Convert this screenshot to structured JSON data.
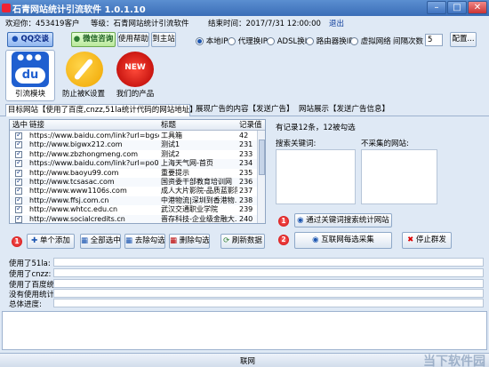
{
  "window": {
    "title": "石青网站统计引流软件 1.0.1.10",
    "min": "–",
    "max": "□",
    "close": "✕"
  },
  "info": {
    "welcome": "欢迎你：453419客户",
    "level": "等级：石青网站统计引流软件",
    "expire": "结束时间：2017/7/31 12:00:00",
    "logout": "退出"
  },
  "toolbar": {
    "qq": "QQ交谈",
    "wechat": "微信咨询",
    "help": "使用帮助",
    "site": "到主站",
    "ip_options": [
      {
        "label": "本地IP",
        "selected": true
      },
      {
        "label": "代理换IP",
        "selected": false
      },
      {
        "label": "ADSL换IP",
        "selected": false
      },
      {
        "label": "路由器换IP",
        "selected": false
      },
      {
        "label": "虚拟网络",
        "selected": false
      }
    ],
    "interval_label": "间隔次数",
    "interval_value": "5",
    "config": "配置..."
  },
  "modules": [
    {
      "label": "引流模块",
      "icon": "baidu-du-icon"
    },
    {
      "label": "防止被K设置",
      "icon": "wrench-icon"
    },
    {
      "label": "我们的产品",
      "icon": "new-badge-icon"
    }
  ],
  "tabs": [
    "目标网站【使用了百度,cnzz,51la统计代码的网站地址】",
    "展现广告的内容【发送广告】",
    "网站展示【发送广告信息】"
  ],
  "grid": {
    "headers": [
      "选中",
      "链接",
      "标题",
      "记录值"
    ],
    "rows": [
      [
        "https://www.baidu.com/link?url=bgsq-mjvwL32q...",
        "工具箱",
        "42"
      ],
      [
        "http://www.bigwx212.com",
        "测试1",
        "231"
      ],
      [
        "http://www.zbzhongmeng.com",
        "测试2",
        "233"
      ],
      [
        "https://www.baidu.com/link?url=po0LdkN7zENv-...",
        "上海天气网-首页",
        "234"
      ],
      [
        "http://www.baoyu99.com",
        "重要提示",
        "235"
      ],
      [
        "http://www.tcsasac.com",
        "国资委干部教育培训网",
        "236"
      ],
      [
        "http://www.www1106s.com",
        "成人大片影院-品质蓝影院",
        "237"
      ],
      [
        "http://www.ffsj.com.cn",
        "中港物流|深圳到香港物...",
        "238"
      ],
      [
        "http://www.whtcc.edu.cn",
        "武汉交通职业学院",
        "239"
      ],
      [
        "http://www.socialcredits.cn",
        "晋存科技-企业级金融大...",
        "240"
      ]
    ]
  },
  "right": {
    "summary": "有记录12条，12被勾选",
    "keywords_label": "搜索关键词:",
    "exclude_label": "不采集的网站:",
    "btn_search": "通过关键词搜索统计网站",
    "btn_collect": "互联网每选采集",
    "btn_stop": "停止群发"
  },
  "actions": {
    "add": "单个添加",
    "select_all": "全部选中",
    "deselect": "去除勾选",
    "delete": "删除勾选",
    "refresh": "刷新数据"
  },
  "stats": [
    "使用了51la:",
    "使用了cnzz:",
    "使用了百度统计:",
    "没有使用统计:",
    "总体进度:"
  ],
  "badges": [
    "1",
    "2"
  ],
  "status": "联网",
  "watermark": "当下软件园"
}
